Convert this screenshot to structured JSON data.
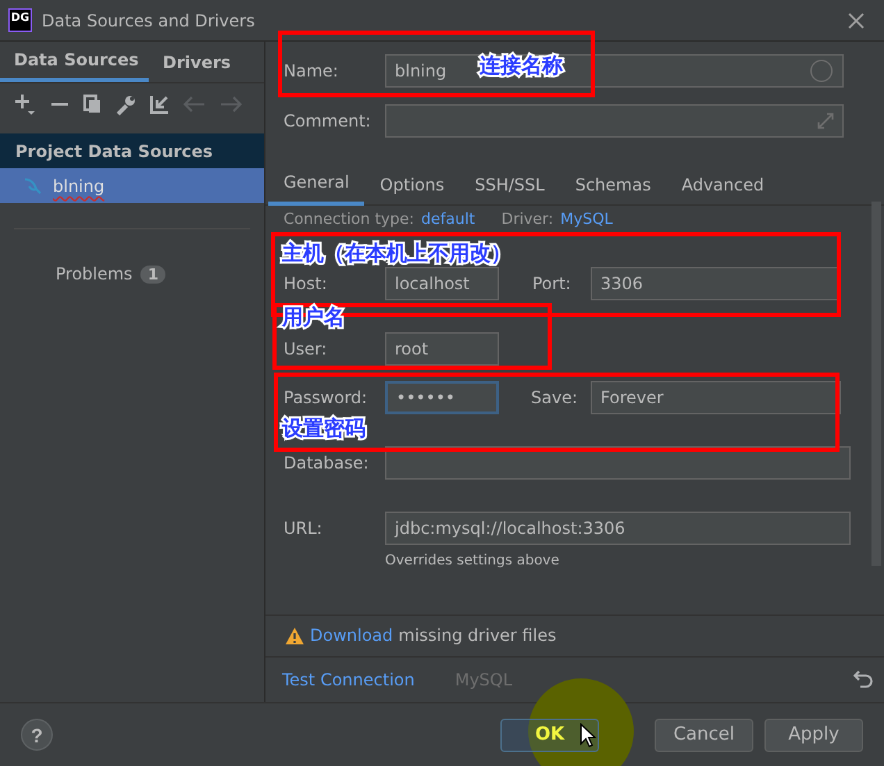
{
  "window": {
    "title": "Data Sources and Drivers",
    "logo": "DG"
  },
  "sidebar": {
    "tabs": [
      {
        "label": "Data Sources",
        "selected": true
      },
      {
        "label": "Drivers",
        "selected": false
      }
    ],
    "section": "Project Data Sources",
    "items": [
      {
        "label": "blning",
        "selected": true
      }
    ],
    "problems": {
      "label": "Problems",
      "count": "1"
    }
  },
  "name": {
    "label": "Name:",
    "value": "blning"
  },
  "comment": {
    "label": "Comment:"
  },
  "tabs": [
    {
      "label": "General",
      "selected": true
    },
    {
      "label": "Options",
      "selected": false
    },
    {
      "label": "SSH/SSL",
      "selected": false
    },
    {
      "label": "Schemas",
      "selected": false
    },
    {
      "label": "Advanced",
      "selected": false
    }
  ],
  "general": {
    "connection_type": {
      "label": "Connection type:",
      "value": "default"
    },
    "driver": {
      "label": "Driver:",
      "value": "MySQL"
    },
    "host": {
      "label": "Host:",
      "value": "localhost"
    },
    "port": {
      "label": "Port:",
      "value": "3306"
    },
    "user": {
      "label": "User:",
      "value": "root"
    },
    "password": {
      "label": "Password:",
      "value": "••••••",
      "focused": true
    },
    "save": {
      "label": "Save:",
      "value": "Forever"
    },
    "database": {
      "label": "Database:"
    },
    "url": {
      "label": "URL:",
      "value": "jdbc:mysql://localhost:3306",
      "hint": "Overrides settings above"
    }
  },
  "warning": {
    "link": "Download",
    "text": "missing driver files"
  },
  "footer": {
    "test_connection": "Test Connection",
    "driver": "MySQL"
  },
  "help": "?",
  "buttons": [
    {
      "label": "OK",
      "kind": "default"
    },
    {
      "label": "Cancel",
      "kind": "normal"
    },
    {
      "label": "Apply",
      "kind": "normal"
    }
  ],
  "annotations": [
    {
      "text": "连接名称"
    },
    {
      "text": "主机（在本机上不用改）"
    },
    {
      "text": "用户名"
    },
    {
      "text": "设置密码"
    }
  ]
}
